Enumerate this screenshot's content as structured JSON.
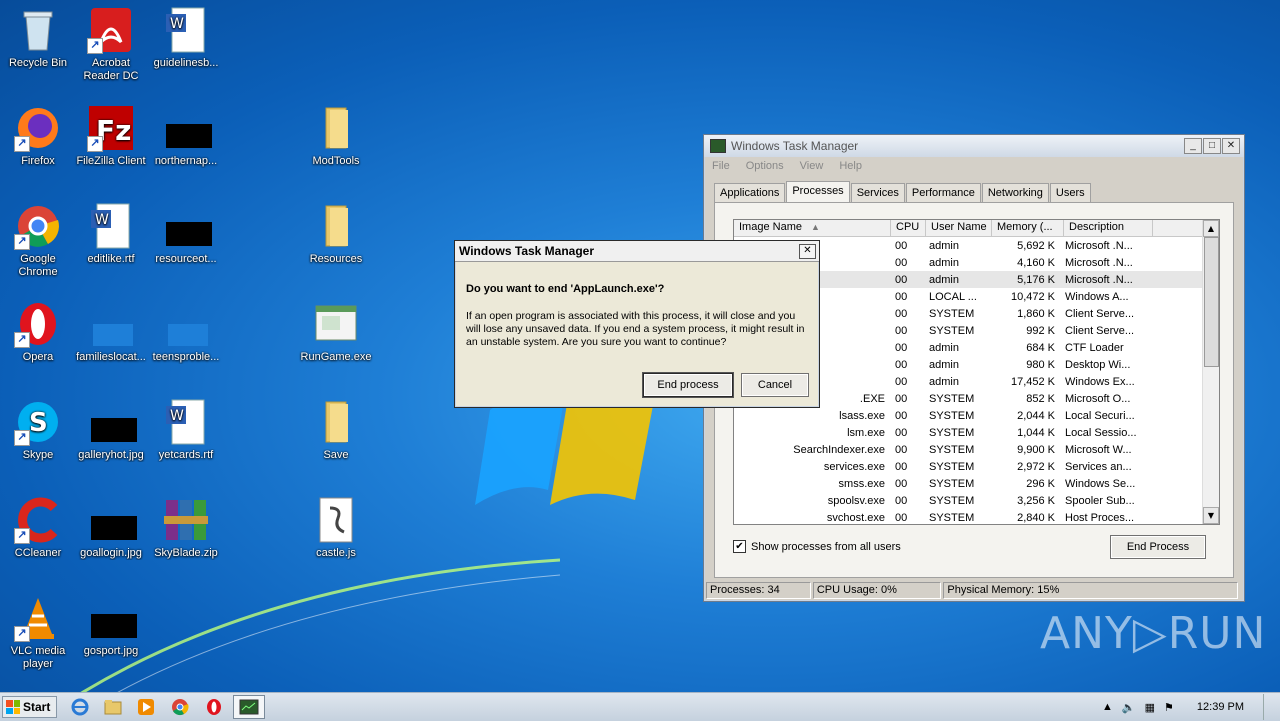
{
  "desktop_icons": [
    {
      "label": "Recycle Bin"
    },
    {
      "label": "Acrobat Reader DC"
    },
    {
      "label": "guidelinesb..."
    },
    {
      "label": "Firefox"
    },
    {
      "label": "FileZilla Client"
    },
    {
      "label": "northernap..."
    },
    {
      "label": "ModTools"
    },
    {
      "label": "Google Chrome"
    },
    {
      "label": "editlike.rtf"
    },
    {
      "label": "resourceot..."
    },
    {
      "label": "Resources"
    },
    {
      "label": "Opera"
    },
    {
      "label": "familieslocat..."
    },
    {
      "label": "teensproble..."
    },
    {
      "label": "RunGame.exe"
    },
    {
      "label": "Skype"
    },
    {
      "label": "galleryhot.jpg"
    },
    {
      "label": "yetcards.rtf"
    },
    {
      "label": "Save"
    },
    {
      "label": "CCleaner"
    },
    {
      "label": "goallogin.jpg"
    },
    {
      "label": "SkyBlade.zip"
    },
    {
      "label": "castle.js"
    },
    {
      "label": "VLC media player"
    },
    {
      "label": "gosport.jpg"
    }
  ],
  "task_manager": {
    "title": "Windows Task Manager",
    "menu": [
      "File",
      "Options",
      "View",
      "Help"
    ],
    "tabs": [
      "Applications",
      "Processes",
      "Services",
      "Performance",
      "Networking",
      "Users"
    ],
    "active_tab": "Processes",
    "columns": [
      "Image Name",
      "CPU",
      "User Name",
      "Memory (...",
      "Description"
    ],
    "rows": [
      {
        "name": "",
        "cpu": "00",
        "user": "admin",
        "mem": "5,692 K",
        "desc": "Microsoft .N..."
      },
      {
        "name": "",
        "cpu": "00",
        "user": "admin",
        "mem": "4,160 K",
        "desc": "Microsoft .N..."
      },
      {
        "name": "",
        "cpu": "00",
        "user": "admin",
        "mem": "5,176 K",
        "desc": "Microsoft .N..."
      },
      {
        "name": "",
        "cpu": "00",
        "user": "LOCAL ...",
        "mem": "10,472 K",
        "desc": "Windows A..."
      },
      {
        "name": "",
        "cpu": "00",
        "user": "SYSTEM",
        "mem": "1,860 K",
        "desc": "Client Serve..."
      },
      {
        "name": "",
        "cpu": "00",
        "user": "SYSTEM",
        "mem": "992 K",
        "desc": "Client Serve..."
      },
      {
        "name": "",
        "cpu": "00",
        "user": "admin",
        "mem": "684 K",
        "desc": "CTF Loader"
      },
      {
        "name": "",
        "cpu": "00",
        "user": "admin",
        "mem": "980 K",
        "desc": "Desktop Wi..."
      },
      {
        "name": "",
        "cpu": "00",
        "user": "admin",
        "mem": "17,452 K",
        "desc": "Windows Ex..."
      },
      {
        "name": ".EXE",
        "cpu": "00",
        "user": "SYSTEM",
        "mem": "852 K",
        "desc": "Microsoft O..."
      },
      {
        "name": "lsass.exe",
        "cpu": "00",
        "user": "SYSTEM",
        "mem": "2,044 K",
        "desc": "Local Securi..."
      },
      {
        "name": "lsm.exe",
        "cpu": "00",
        "user": "SYSTEM",
        "mem": "1,044 K",
        "desc": "Local Sessio..."
      },
      {
        "name": "SearchIndexer.exe",
        "cpu": "00",
        "user": "SYSTEM",
        "mem": "9,900 K",
        "desc": "Microsoft W..."
      },
      {
        "name": "services.exe",
        "cpu": "00",
        "user": "SYSTEM",
        "mem": "2,972 K",
        "desc": "Services an..."
      },
      {
        "name": "smss.exe",
        "cpu": "00",
        "user": "SYSTEM",
        "mem": "296 K",
        "desc": "Windows Se..."
      },
      {
        "name": "spoolsv.exe",
        "cpu": "00",
        "user": "SYSTEM",
        "mem": "3,256 K",
        "desc": "Spooler Sub..."
      },
      {
        "name": "svchost.exe",
        "cpu": "00",
        "user": "SYSTEM",
        "mem": "2,840 K",
        "desc": "Host Proces..."
      }
    ],
    "selected_row_index": 2,
    "show_all_label": "Show processes from all users",
    "show_all_checked": true,
    "end_process_label": "End Process",
    "status": {
      "processes": "Processes: 34",
      "cpu": "CPU Usage: 0%",
      "memory": "Physical Memory: 15%"
    }
  },
  "dialog": {
    "title": "Windows Task Manager",
    "question": "Do you want to end 'AppLaunch.exe'?",
    "message": "If an open program is associated with this process, it will close and you will lose any unsaved data. If you end a system process, it might result in an unstable system. Are you sure you want to continue?",
    "confirm_label": "End process",
    "cancel_label": "Cancel"
  },
  "taskbar": {
    "start_label": "Start",
    "clock": "12:39 PM"
  },
  "watermark": "ANY▷RUN"
}
